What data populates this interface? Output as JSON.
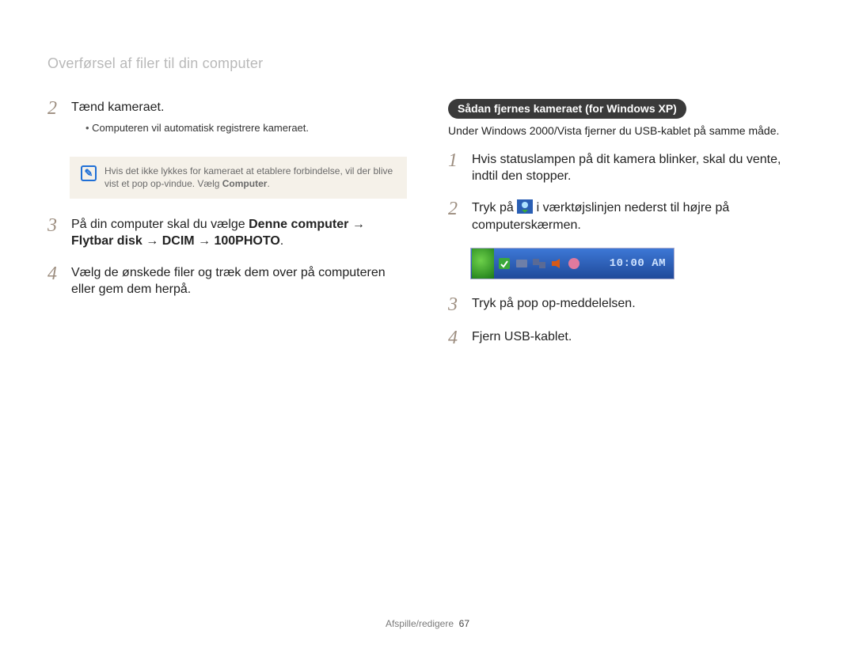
{
  "page_title": "Overførsel af filer til din computer",
  "left": {
    "step2": {
      "num": "2",
      "text": "Tænd kameraet.",
      "bullet": "Computeren vil automatisk registrere kameraet."
    },
    "note": {
      "text_a": "Hvis det ikke lykkes for kameraet at etablere forbindelse, vil der blive vist et pop op-vindue. Vælg ",
      "text_bold": "Computer",
      "text_b": "."
    },
    "step3": {
      "num": "3",
      "pre": "På din computer skal du vælge ",
      "b1": "Denne computer",
      "arrow": " → ",
      "b2": "Flytbar disk",
      "b3": "DCIM",
      "b4": "100PHOTO",
      "tail": "."
    },
    "step4": {
      "num": "4",
      "text": "Vælg de ønskede filer og træk dem over på computeren eller gem dem herpå."
    }
  },
  "right": {
    "pill": "Sådan fjernes kameraet (for Windows XP)",
    "sub": "Under Windows 2000/Vista fjerner du USB-kablet på samme måde.",
    "step1": {
      "num": "1",
      "text": "Hvis statuslampen på dit kamera blinker, skal du vente, indtil den stopper."
    },
    "step2": {
      "num": "2",
      "pre": "Tryk på ",
      "post": " i værktøjslinjen nederst til højre på computerskærmen."
    },
    "taskbar_clock": "10:00 AM",
    "step3": {
      "num": "3",
      "text": "Tryk på pop op-meddelelsen."
    },
    "step4": {
      "num": "4",
      "text": "Fjern USB-kablet."
    }
  },
  "footer": {
    "section": "Afspille/redigere",
    "page": "67"
  }
}
